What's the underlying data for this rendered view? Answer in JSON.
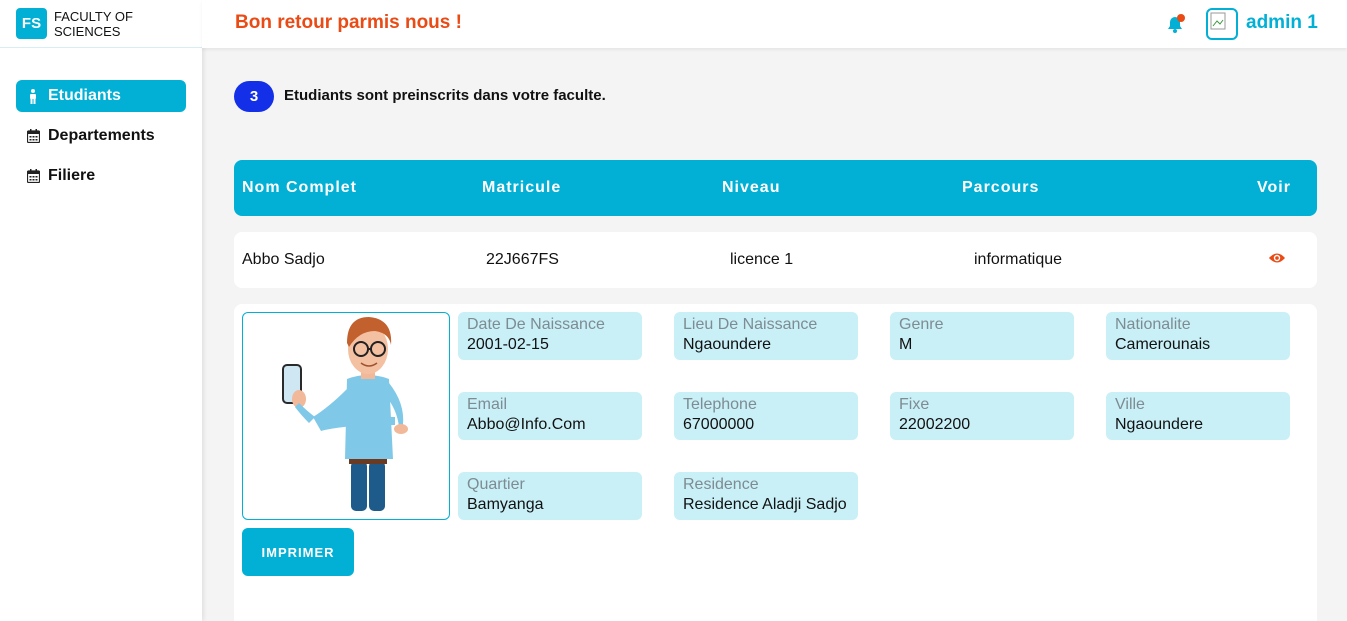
{
  "brand": {
    "logo": "FS",
    "name": "FACULTY OF SCIENCES"
  },
  "sidebar": {
    "items": [
      {
        "label": "Etudiants",
        "icon": "person-icon",
        "active": true
      },
      {
        "label": "Departements",
        "icon": "calendar-icon",
        "active": false
      },
      {
        "label": "Filiere",
        "icon": "calendar-icon",
        "active": false
      }
    ]
  },
  "header": {
    "welcome": "Bon retour parmis nous !",
    "user": "admin 1"
  },
  "summary": {
    "count": "3",
    "text": "Etudiants sont preinscrits dans votre faculte."
  },
  "table": {
    "columns": [
      "Nom Complet",
      "Matricule",
      "Niveau",
      "Parcours",
      "Voir"
    ],
    "rows": [
      {
        "nom": "Abbo Sadjo",
        "matricule": "22J667FS",
        "niveau": "licence 1",
        "parcours": "informatique"
      }
    ]
  },
  "details": {
    "fields": [
      {
        "label": "Date De Naissance",
        "value": "2001-02-15"
      },
      {
        "label": "Lieu De Naissance",
        "value": "Ngaoundere"
      },
      {
        "label": "Genre",
        "value": "M"
      },
      {
        "label": "Nationalite",
        "value": "Camerounais"
      },
      {
        "label": "Email",
        "value": "Abbo@Info.Com"
      },
      {
        "label": "Telephone",
        "value": "67000000"
      },
      {
        "label": "Fixe",
        "value": "22002200"
      },
      {
        "label": "Ville",
        "value": "Ngaoundere"
      },
      {
        "label": "Quartier",
        "value": "Bamyanga"
      },
      {
        "label": "Residence",
        "value": "Residence Aladji Sadjo"
      }
    ],
    "print_label": "IMPRIMER"
  },
  "colors": {
    "accent": "#02b0d6",
    "welcome": "#ea4a14",
    "badge": "#1330e8",
    "field_bg": "#c9eff7"
  }
}
